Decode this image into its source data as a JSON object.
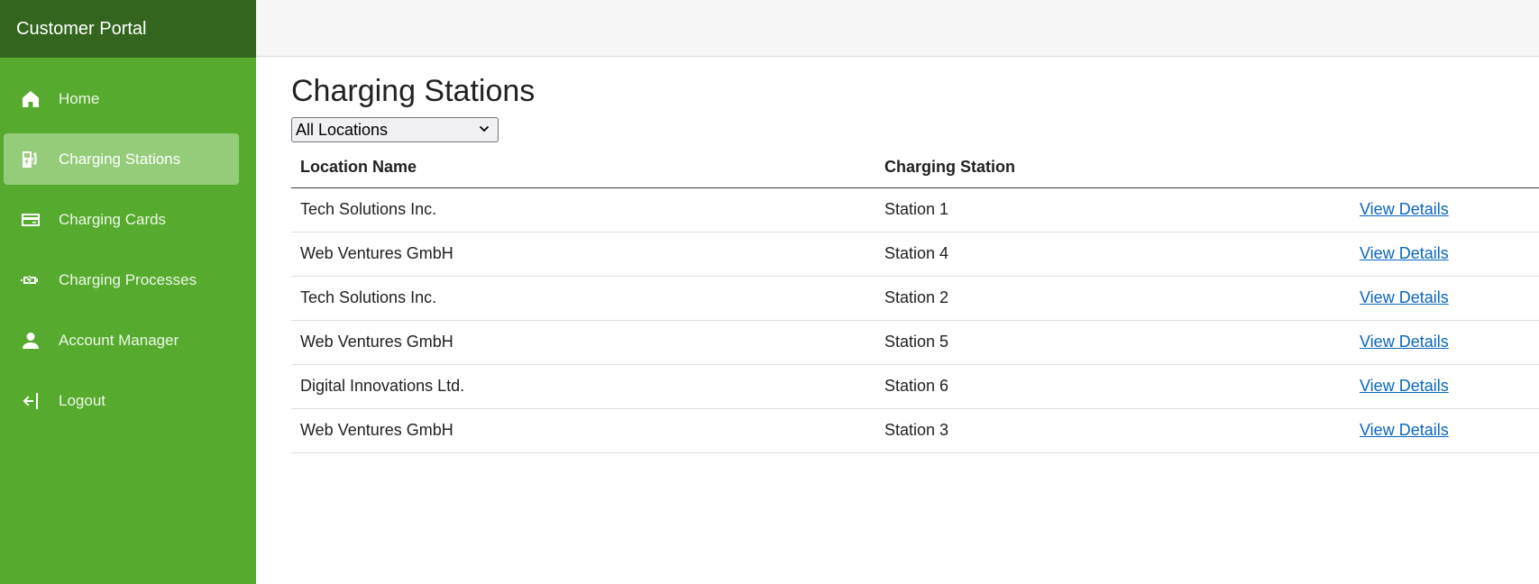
{
  "sidebar": {
    "title": "Customer Portal",
    "items": [
      {
        "label": "Home",
        "icon": "home-icon"
      },
      {
        "label": "Charging Stations",
        "icon": "ev-station-icon",
        "active": true
      },
      {
        "label": "Charging Cards",
        "icon": "card-icon"
      },
      {
        "label": "Charging Processes",
        "icon": "charging-process-icon"
      },
      {
        "label": "Account Manager",
        "icon": "person-icon"
      },
      {
        "label": "Logout",
        "icon": "logout-icon"
      }
    ]
  },
  "main": {
    "title": "Charging Stations",
    "filter": {
      "selected": "All Locations"
    },
    "table": {
      "headers": [
        "Location Name",
        "Charging Station",
        ""
      ],
      "rows": [
        {
          "location": "Tech Solutions Inc.",
          "station": "Station 1",
          "action": "View Details"
        },
        {
          "location": "Web Ventures GmbH",
          "station": "Station 4",
          "action": "View Details"
        },
        {
          "location": "Tech Solutions Inc.",
          "station": "Station 2",
          "action": "View Details"
        },
        {
          "location": "Web Ventures GmbH",
          "station": "Station 5",
          "action": "View Details"
        },
        {
          "location": "Digital Innovations Ltd.",
          "station": "Station 6",
          "action": "View Details"
        },
        {
          "location": "Web Ventures GmbH",
          "station": "Station 3",
          "action": "View Details"
        }
      ]
    }
  },
  "colors": {
    "sidebar": "#56aa2e",
    "sidebar_header": "#33651f",
    "active_item": "#95cc7a",
    "link": "#0a66c2"
  }
}
